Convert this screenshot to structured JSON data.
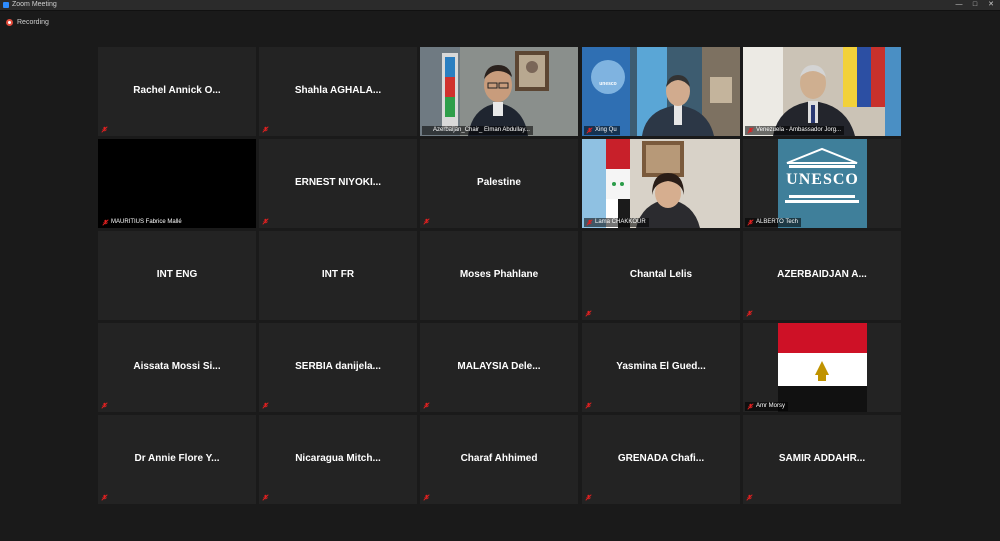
{
  "window": {
    "title": "Zoom Meeting",
    "controls": [
      "—",
      "□",
      "✕"
    ]
  },
  "recording": {
    "label": "Recording",
    "color": "#e24b3b"
  },
  "colors": {
    "active_border": "#c9e65c",
    "tile_bg": "#232323",
    "mute": "#e02020"
  },
  "participants": [
    {
      "name": "Rachel Annick O...",
      "label": ""
    },
    {
      "name": "Shahla AGHALA...",
      "label": ""
    },
    {
      "name": "",
      "label": "Azerbaijan_Chair_ Elman Abdullay..."
    },
    {
      "name": "",
      "label": "Xing Qu"
    },
    {
      "name": "",
      "label": "Venezuela - Ambassador Jorg..."
    },
    {
      "name": "",
      "label": "MAURITIUS Fabrice Mallé"
    },
    {
      "name": "ERNEST NIYOKI...",
      "label": ""
    },
    {
      "name": "Palestine",
      "label": ""
    },
    {
      "name": "",
      "label": "Lama CHAKKOUR"
    },
    {
      "name": "",
      "label": "ALBERTO Tech"
    },
    {
      "name": "INT ENG",
      "label": ""
    },
    {
      "name": "INT FR",
      "label": ""
    },
    {
      "name": "Moses Phahlane",
      "label": ""
    },
    {
      "name": "Chantal Lelis",
      "label": ""
    },
    {
      "name": "AZERBAIDJAN A...",
      "label": ""
    },
    {
      "name": "Aissata Mossi Si...",
      "label": ""
    },
    {
      "name": "SERBIA danijela...",
      "label": ""
    },
    {
      "name": "MALAYSIA Dele...",
      "label": ""
    },
    {
      "name": "Yasmina El Gued...",
      "label": ""
    },
    {
      "name": "",
      "label": "Amr Morsy"
    },
    {
      "name": "Dr Annie Flore Y...",
      "label": ""
    },
    {
      "name": "Nicaragua Mitch...",
      "label": ""
    },
    {
      "name": "Charaf Ahhimed",
      "label": ""
    },
    {
      "name": "GRENADA Chafi...",
      "label": ""
    },
    {
      "name": "SAMIR ADDAHR...",
      "label": ""
    }
  ],
  "logos": {
    "unesco_text": "UNESCO",
    "un_badge": "unesco"
  }
}
